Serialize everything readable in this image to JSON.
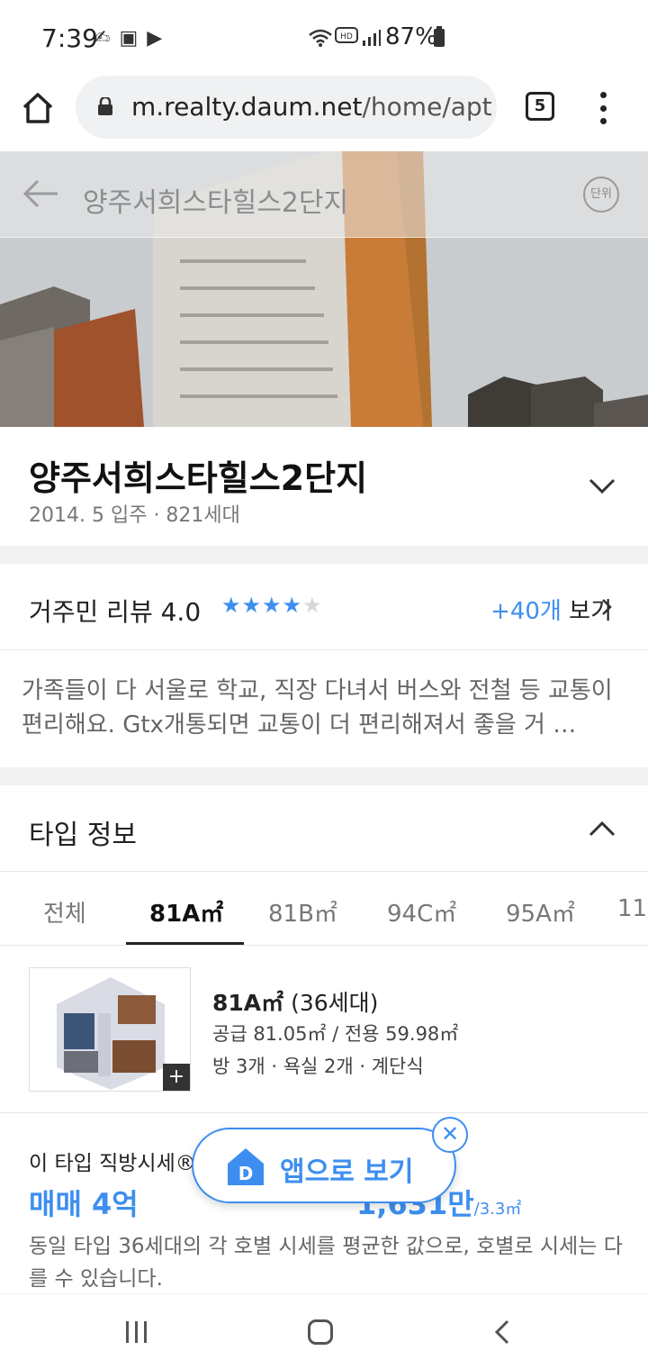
{
  "status_bar": {
    "time": "7:39",
    "battery": "87%",
    "icons": [
      "gesture-icon",
      "gallery-icon",
      "play-store-icon",
      "wifi-icon",
      "hd-voice-icon",
      "signal-icon",
      "battery-icon"
    ]
  },
  "browser": {
    "url_host": "m.realty.daum.net",
    "url_path": "/home/apt",
    "tab_count": "5"
  },
  "hero": {
    "title": "양주서희스타힐스2단지",
    "unit_label": "단위"
  },
  "apartment": {
    "name": "양주서희스타힐스2단지",
    "meta": "2014. 5 입주 · 821세대"
  },
  "review": {
    "label": "거주민 리뷰 4.0",
    "rating": 4.0,
    "count_label": "+40개",
    "more_label": " 보기",
    "text": "가족들이 다 서울로 학교, 직장 다녀서 버스와 전철 등 교통이 편리해요. Gtx개통되면 교통이 더 편리해져서 좋을 거 …"
  },
  "type_info": {
    "title": "타입 정보",
    "tabs": [
      "전체",
      "81A㎡",
      "81B㎡",
      "94C㎡",
      "95A㎡",
      "11"
    ],
    "active_tab": "81A㎡",
    "plan": {
      "type": "81A㎡",
      "households": " (36세대)",
      "area": "공급 81.05㎡ / 전용 59.98㎡",
      "rooms": "방 3개 · 욕실 2개 · 계단식"
    }
  },
  "price": {
    "label": "이 타입 직방시세®",
    "main": "매매 4억",
    "per_area": "1,631만",
    "per_area_unit": "/3.3㎡",
    "note": "동일 타입 36세대의 각 호별 시세를 평균한 값으로, 호별로 시세는 다를 수 있습니다."
  },
  "app_banner": {
    "label": "앱으로 보기",
    "close": "✕"
  }
}
